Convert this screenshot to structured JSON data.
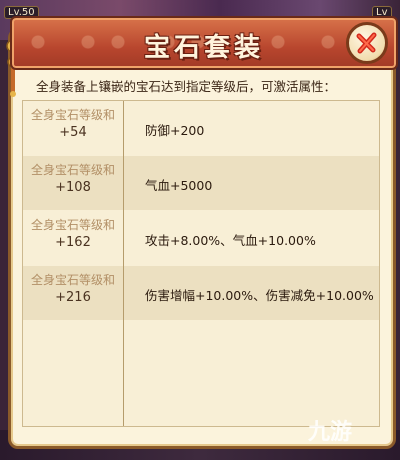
{
  "background": {
    "lv_left": "Lv.50",
    "lv_right": "Lv"
  },
  "dialog": {
    "title": "宝石套装",
    "intro": "全身装备上镶嵌的宝石达到指定等级后，可激活属性：",
    "rows": [
      {
        "condition_label": "全身宝石等级和",
        "condition_value": "+54",
        "attribute": "防御+200"
      },
      {
        "condition_label": "全身宝石等级和",
        "condition_value": "+108",
        "attribute": "气血+5000"
      },
      {
        "condition_label": "全身宝石等级和",
        "condition_value": "+162",
        "attribute": "攻击+8.00%、气血+10.00%"
      },
      {
        "condition_label": "全身宝石等级和",
        "condition_value": "+216",
        "attribute": "伤害增幅+10.00%、伤害减免+10.00%"
      }
    ],
    "close_icon": "close-x-icon"
  },
  "watermark": "九游",
  "colors": {
    "title_bar": "#b8462e",
    "panel_bg": "#fbf3dc",
    "row_alt": "#ece0c1",
    "condition_text": "#b28f66"
  }
}
